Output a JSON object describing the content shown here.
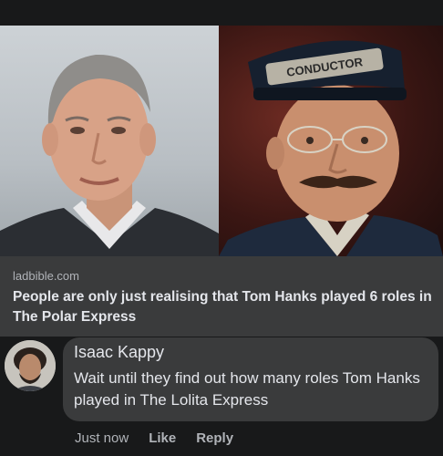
{
  "post": {
    "left_image": "photo-actor-portrait",
    "right_image": "photo-conductor-character",
    "conductor_hat_text": "CONDUCTOR",
    "link": {
      "domain": "ladbible.com",
      "title": "People are only just realising that Tom Hanks played 6 roles in The Polar Express"
    }
  },
  "comment": {
    "author": "Isaac Kappy",
    "text": "Wait until they find out how many roles Tom Hanks played in The Lolita Express",
    "timestamp": "Just now",
    "like_label": "Like",
    "reply_label": "Reply"
  },
  "colors": {
    "background": "#18191a",
    "card": "#3a3b3c",
    "text": "#e4e6eb",
    "secondary_text": "#b0b3b8"
  }
}
